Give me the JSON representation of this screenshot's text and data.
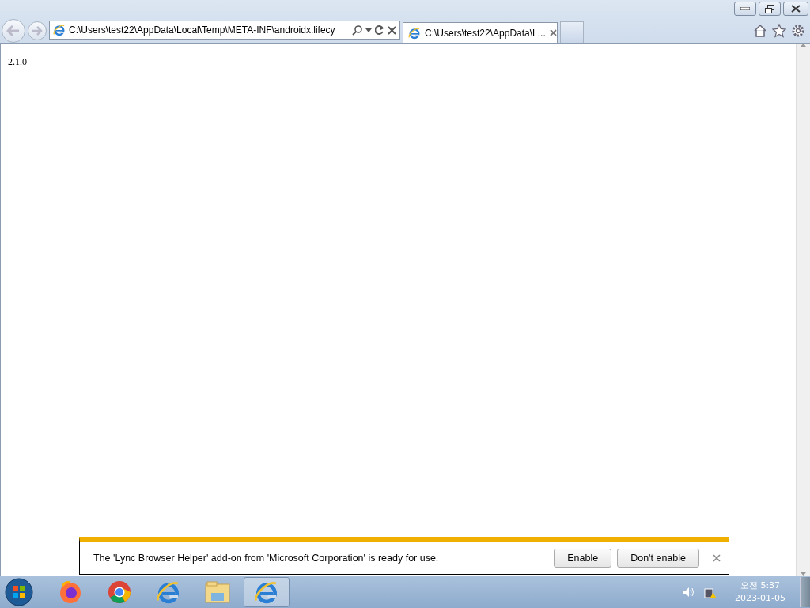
{
  "address_bar": {
    "url": "C:\\Users\\test22\\AppData\\Local\\Temp\\META-INF\\androidx.lifecy"
  },
  "tabs": [
    {
      "title": "C:\\Users\\test22\\AppData\\L...",
      "selected": true
    }
  ],
  "page": {
    "text": "2.1.0"
  },
  "notification": {
    "message": "The 'Lync Browser Helper' add-on from 'Microsoft Corporation' is ready for use.",
    "buttons": [
      "Enable",
      "Don't enable"
    ]
  },
  "taskbar": {
    "items": [
      {
        "kind": "firefox",
        "selected": false
      },
      {
        "kind": "chrome",
        "selected": false
      },
      {
        "kind": "ie",
        "selected": false
      },
      {
        "kind": "folder",
        "selected": false
      },
      {
        "kind": "ie",
        "selected": true
      }
    ],
    "clock": {
      "time": "오전 5:37",
      "date": "2023-01-05"
    }
  }
}
